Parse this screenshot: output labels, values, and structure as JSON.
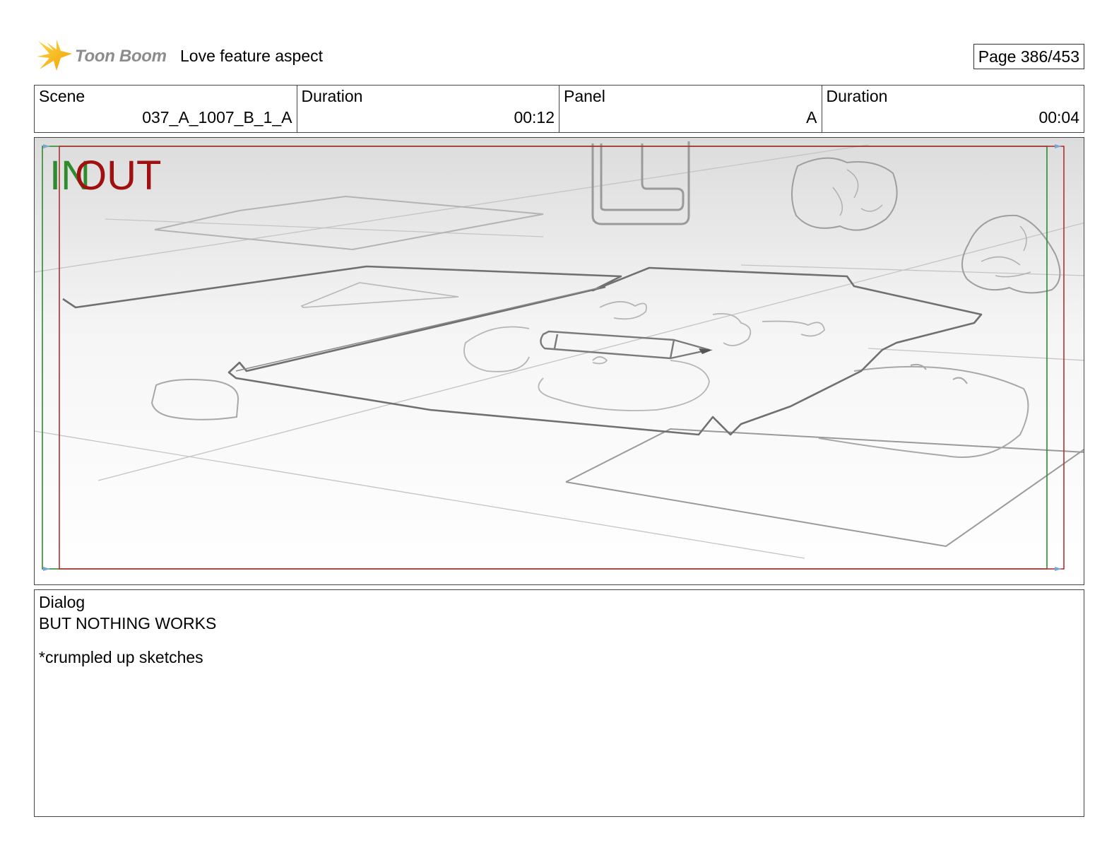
{
  "header": {
    "logo_text": "Toon Boom",
    "project_title": "Love feature aspect",
    "page_label": "Page 386/453"
  },
  "info": {
    "scene_label": "Scene",
    "scene_value": "037_A_1007_B_1_A",
    "scene_duration_label": "Duration",
    "scene_duration_value": "00:12",
    "panel_label": "Panel",
    "panel_value": "A",
    "panel_duration_label": "Duration",
    "panel_duration_value": "00:04"
  },
  "frame": {
    "in_label": "IN",
    "out_label": "OUT"
  },
  "dialog": {
    "label": "Dialog",
    "lines": [
      "BUT NOTHING WORKS",
      "*crumpled up sketches"
    ]
  },
  "colors": {
    "in_marker": "#2e8b2e",
    "out_marker": "#a01010",
    "logo_star": "#f5b800"
  }
}
